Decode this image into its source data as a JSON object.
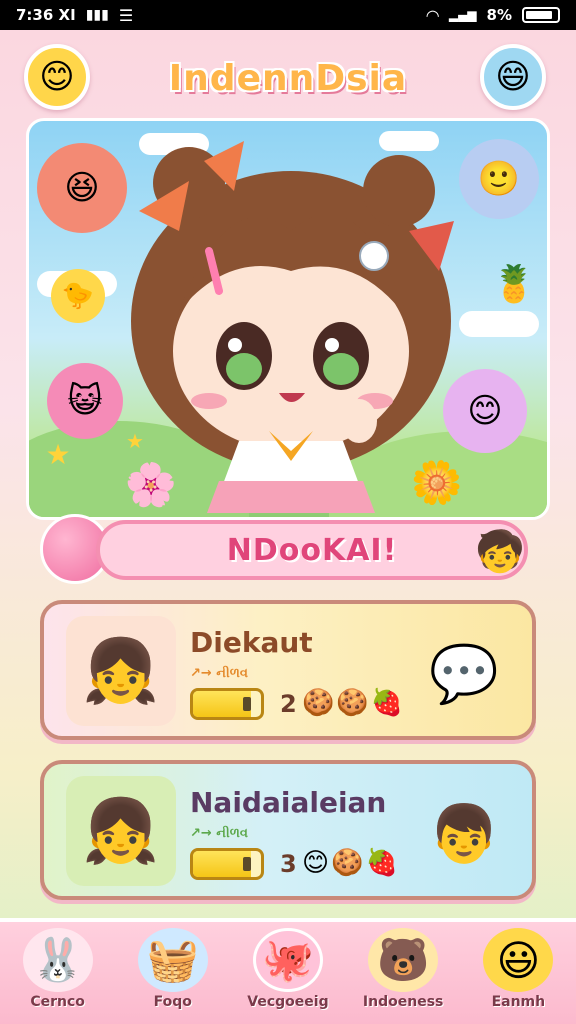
{
  "status_bar": {
    "time": "7:36 XI",
    "right_text": "8%"
  },
  "header": {
    "title": "IndennDsia",
    "left_avatar_icon": "blonde-girl-avatar-icon",
    "right_avatar_icon": "red-hair-girl-avatar-icon"
  },
  "hero": {
    "main_character_icon": "brown-hair-chibi-girl-icon"
  },
  "banner": {
    "label": "NDooKAI!"
  },
  "cards": [
    {
      "title": "Diekaut",
      "subtitle": "↗→ નીળવ",
      "count": "2",
      "progress": 0.85
    },
    {
      "title": "Naidaialeian",
      "subtitle": "↗→ નીળવ",
      "count": "3",
      "progress": 0.85
    }
  ],
  "bottom_nav": [
    {
      "label": "Cernco",
      "icon": "bunny-icon"
    },
    {
      "label": "Foqo",
      "icon": "rainbow-basket-icon"
    },
    {
      "label": "Vecgoeeig",
      "icon": "pink-blob-icon"
    },
    {
      "label": "Indoeness",
      "icon": "bear-icon"
    },
    {
      "label": "Eanmh",
      "icon": "chat-smiley-icon"
    }
  ]
}
